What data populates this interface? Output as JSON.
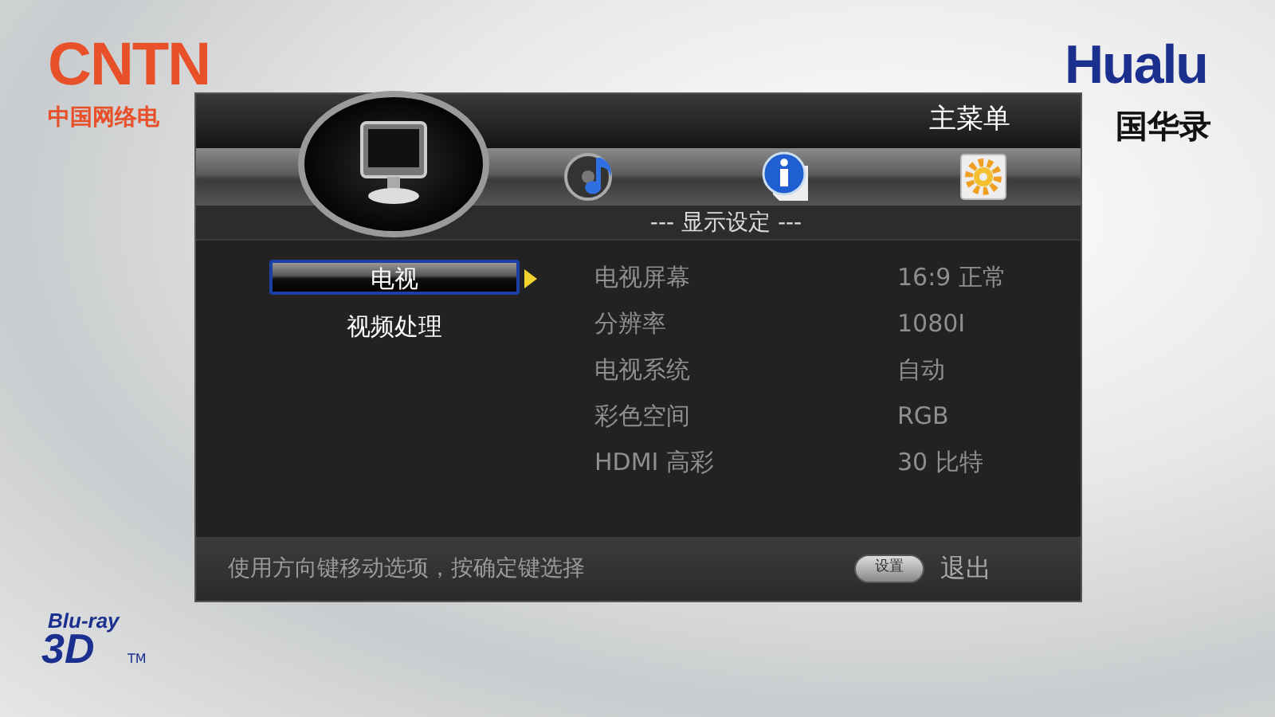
{
  "logos": {
    "cntn": "CNTN",
    "cntn_caption": "中国网络电",
    "brand": "Hualu",
    "brand_caption": "国华录",
    "bluray": "Blu-ray",
    "bluray_3d": "3D",
    "trademark": "TM"
  },
  "menu": {
    "title": "主菜单",
    "tabs": [
      {
        "kind": "display",
        "selected": true
      },
      {
        "kind": "music",
        "selected": false
      },
      {
        "kind": "info",
        "selected": false
      },
      {
        "kind": "settings",
        "selected": false
      }
    ],
    "section": "--- 显示设定 ---",
    "categories": [
      {
        "label": "电视",
        "selected": true
      },
      {
        "label": "视频处理",
        "selected": false
      }
    ],
    "settings": [
      {
        "label": "电视屏幕",
        "value": "16:9 正常"
      },
      {
        "label": "分辨率",
        "value": "1080I"
      },
      {
        "label": "电视系统",
        "value": "自动"
      },
      {
        "label": "彩色空间",
        "value": "RGB"
      },
      {
        "label": "HDMI 高彩",
        "value": "30 比特"
      }
    ],
    "footer": {
      "hint": "使用方向键移动选项，按确定键选择",
      "key": "设置",
      "action": "退出"
    }
  }
}
